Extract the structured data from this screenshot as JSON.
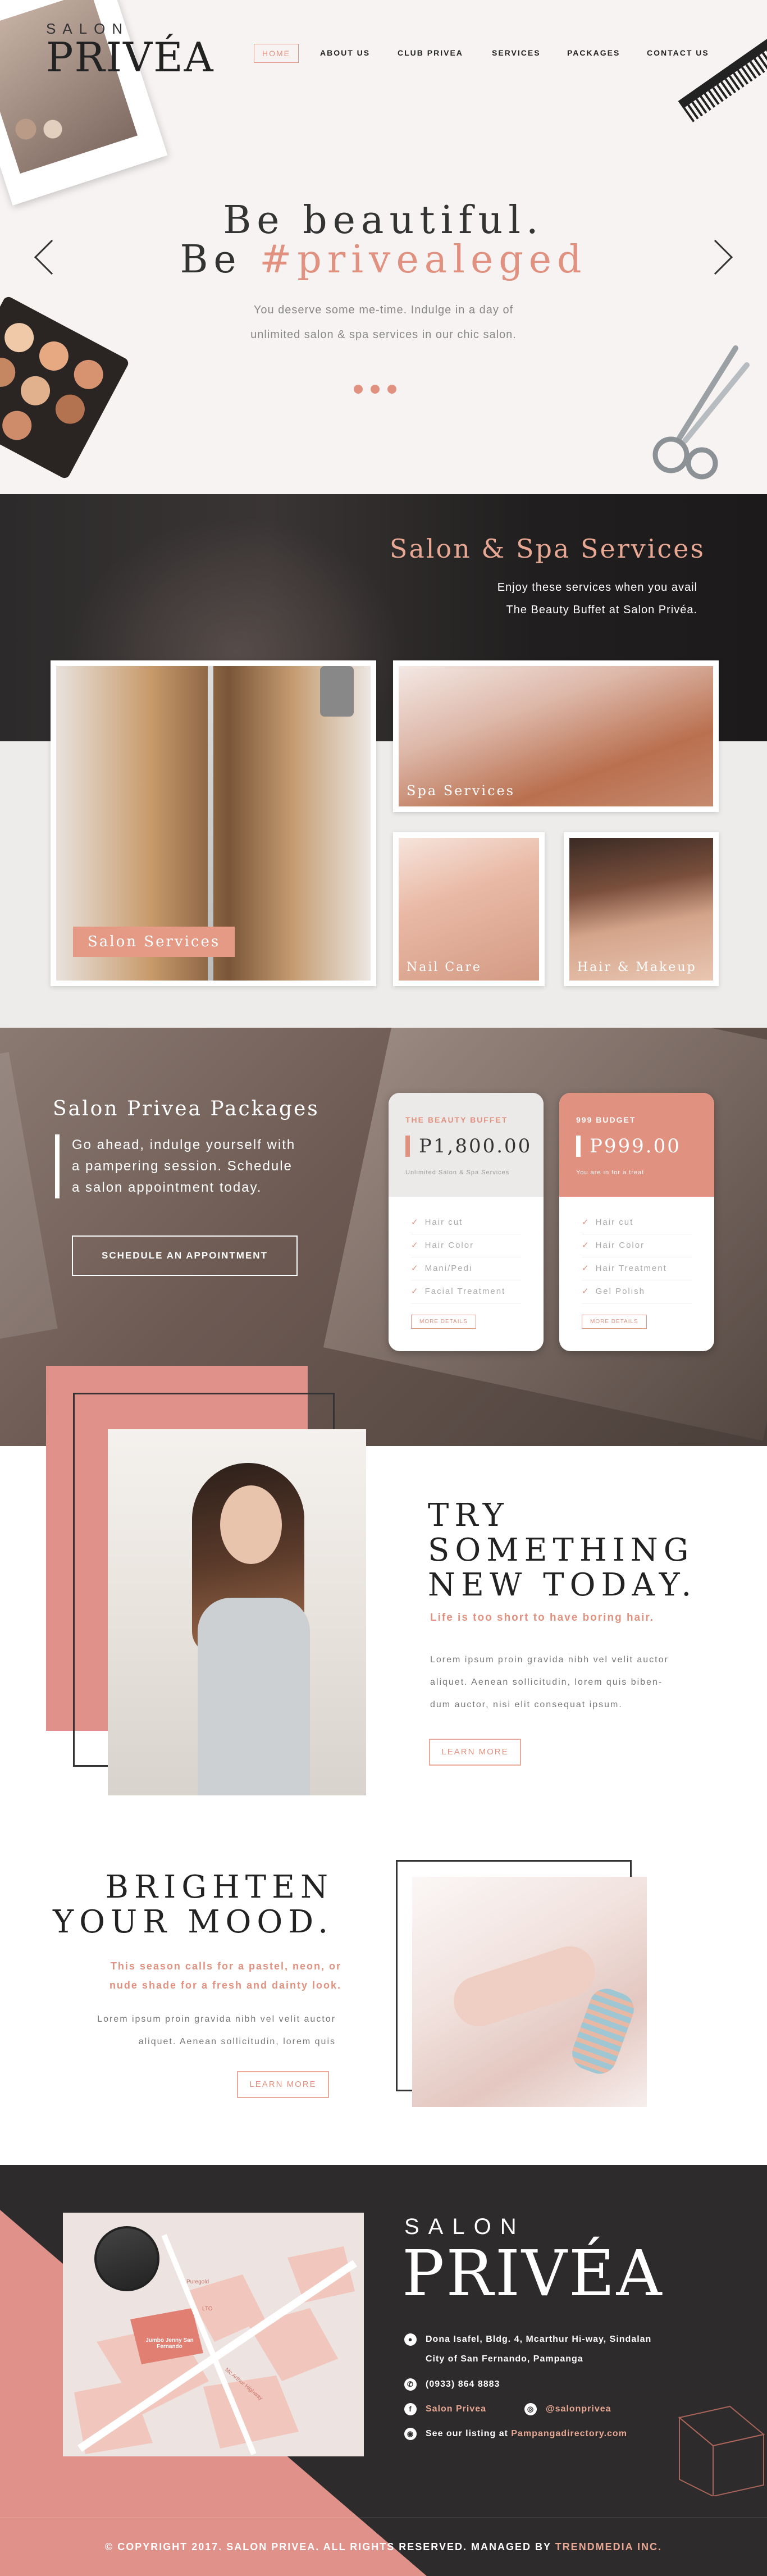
{
  "brand": {
    "small": "SALON",
    "big": "PRIVÉA"
  },
  "nav": {
    "items": [
      "HOME",
      "ABOUT US",
      "CLUB PRIVEA",
      "SERVICES",
      "PACKAGES",
      "CONTACT US"
    ]
  },
  "hero": {
    "line1": "Be beautiful.",
    "line2_prefix": "Be",
    "line2_hash": "#privealeged",
    "sub1": "You deserve some me-time. Indulge in a day of",
    "sub2": "unlimited salon & spa services in our chic salon."
  },
  "services": {
    "title": "Salon & Spa Services",
    "desc1": "Enjoy these services when you avail",
    "desc2": "The Beauty Buffet at Salon Privéa.",
    "cards": [
      "Salon Services",
      "Spa Services",
      "Nail Care",
      "Hair & Makeup"
    ]
  },
  "packages": {
    "title": "Salon Privea Packages",
    "desc1": "Go ahead, indulge yourself with",
    "desc2": "a pampering session. Schedule",
    "desc3": "a salon appointment today.",
    "cta": "SCHEDULE AN APPOINTMENT",
    "cards": [
      {
        "tag": "THE BEAUTY BUFFET",
        "price": "P1,800.00",
        "note": "Unlimited Salon & Spa Services",
        "items": [
          "Hair cut",
          "Hair Color",
          "Mani/Pedi",
          "Facial Treatment"
        ],
        "more": "MORE DETAILS"
      },
      {
        "tag": "999 BUDGET",
        "price": "P999.00",
        "note": "You are in for a treat",
        "items": [
          "Hair cut",
          "Hair Color",
          "Hair Treatment",
          "Gel Polish"
        ],
        "more": "MORE DETAILS"
      }
    ]
  },
  "try": {
    "line1": "TRY",
    "line2": "SOMETHING",
    "line3": "NEW TODAY.",
    "accent": "Life is too short to have boring hair.",
    "body1": "Lorem ipsum proin gravida nibh vel velit auctor",
    "body2": "aliquet. Aenean sollicitudin, lorem quis biben-",
    "body3": "dum auctor, nisi elit consequat ipsum.",
    "btn": "LEARN MORE"
  },
  "brighten": {
    "line1": "BRIGHTEN",
    "line2": "YOUR MOOD.",
    "accent1": "This season calls for a pastel, neon, or",
    "accent2": "nude shade for a fresh and dainty look.",
    "body1": "Lorem ipsum proin gravida nibh vel velit auctor",
    "body2": "aliquet. Aenean sollicitudin, lorem quis",
    "btn": "LEARN MORE"
  },
  "footer": {
    "address1": "Dona Isafel, Bldg. 4, Mcarthur Hi-way, Sindalan",
    "address2": "City of San Fernando, Pampanga",
    "phone": "(0933) 864 8883",
    "facebook": "Salon Privea",
    "instagram": "@salonprivea",
    "listing_prefix": "See our listing at",
    "listing_link": "Pampangadirectory.com",
    "copyright_prefix": "© COPYRIGHT 2017. SALON PRIVEA. ALL RIGHTS RESERVED. MANAGED BY",
    "copyright_link": "TRENDMEDIA INC.",
    "map_labels": [
      "Jumbo Jenny San Fernando",
      "Mc Arthur Highway",
      "Puregold",
      "LTO"
    ]
  },
  "colors": {
    "accent": "#e0917f",
    "dark": "#2d2b2c",
    "light_bg": "#f7f3f3"
  }
}
